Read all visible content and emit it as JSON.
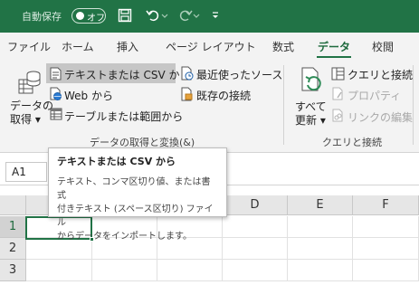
{
  "titlebar": {
    "autosave_label": "自動保存",
    "autosave_state": "オフ"
  },
  "tabs": [
    "ファイル",
    "ホーム",
    "挿入",
    "ページ レイアウト",
    "数式",
    "データ",
    "校閲"
  ],
  "active_tab": "データ",
  "ribbon": {
    "get_data": {
      "line1": "データの",
      "line2": "取得 ▾"
    },
    "from_text_csv": "テキストまたは CSV から",
    "from_web": "Web から",
    "from_table": "テーブルまたは範囲から",
    "recent_sources": "最近使ったソース",
    "existing_connections": "既存の接続",
    "group_get_transform": "データの取得と変換(&)",
    "refresh_all": {
      "line1": "すべて",
      "line2": "更新 ▾"
    },
    "queries_connections": "クエリと接続",
    "properties": "プロパティ",
    "edit_links": "リンクの編集",
    "group_queries": "クエリと接続"
  },
  "namebox": "A1",
  "columns": [
    "A",
    "B",
    "C",
    "D",
    "E",
    "F"
  ],
  "rows": [
    "1",
    "2",
    "3"
  ],
  "tooltip": {
    "title": "テキストまたは CSV から",
    "line1": "テキスト、コンマ区切り値、または書式",
    "line2": "付きテキスト (スペース区切り) ファイル",
    "line3": "からデータをインポートします。"
  }
}
